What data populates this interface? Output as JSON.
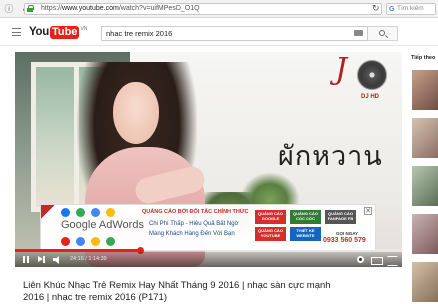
{
  "browser": {
    "url_prefix": "https://",
    "url_host": "www.youtube.com",
    "url_path": "/watch?v=uifMPesD_O1Q",
    "search_placeholder": "Tìm kiếm"
  },
  "header": {
    "logo_you": "You",
    "logo_tube": "Tube",
    "logo_region": "VN",
    "search_query": "nhac tre remix 2016"
  },
  "player": {
    "brand_text": "ผักหวาน",
    "dj_badge": "DJ HD",
    "time_label": "24:16 / 1:14:39",
    "progress_fraction": 0.325
  },
  "ad": {
    "logo_text": "Google AdWords",
    "headline": "QUẢNG CÁO BỞI ĐỐI TÁC CHÍNH THỨC",
    "line1": "Chi Phí Thấp - Hiệu Quả Bất Ngờ",
    "line2": "Mang Khách Hàng Đến Với Bạn",
    "tiles": [
      "QUẢNG CÁO GOOGLE",
      "QUẢNG CÁO CỐC CỐC",
      "QUẢNG CÁO FANPAGE FB",
      "QUẢNG CÁO YOUTUBE",
      "THIẾT KẾ WEBSITE"
    ],
    "phone_label": "GỌI NGAY",
    "phone_number": "0933 560 579",
    "close_label": "✕"
  },
  "video": {
    "title": "Liên Khúc Nhạc Trẻ Remix Hay Nhất Tháng 9 2016 | nhạc sàn cực mạnh 2016 | nhạc tre remix 2016 (P171)"
  },
  "sidebar": {
    "up_next_label": "Tiếp theo"
  },
  "colors": {
    "youtube_red": "#e62117",
    "ad_red": "#c62828",
    "tile_red": "#d32f2f",
    "tile_green": "#2e7d32",
    "tile_gray": "#555555",
    "tile_blue": "#1565c0"
  }
}
